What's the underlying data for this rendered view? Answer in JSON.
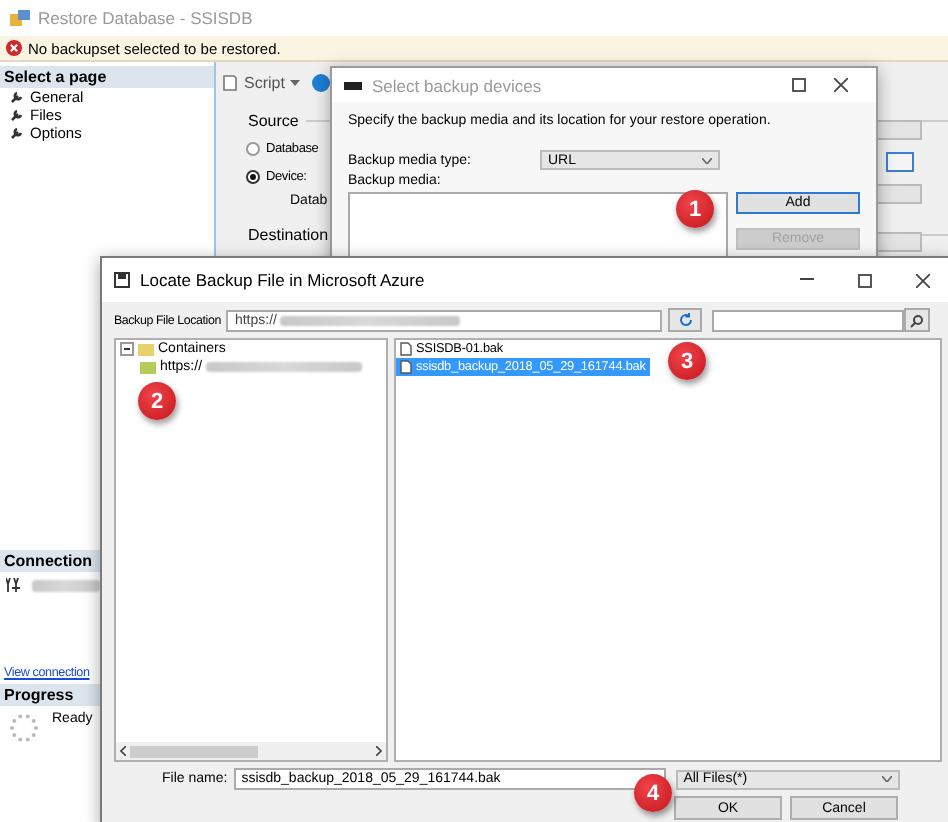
{
  "main_window": {
    "title": "Restore Database - SSISDB",
    "message": "No backupset selected to be restored.",
    "sidebar": {
      "header": "Select a page",
      "items": [
        {
          "label": "General"
        },
        {
          "label": "Files"
        },
        {
          "label": "Options"
        }
      ]
    },
    "connection": {
      "header": "Connection",
      "link": "View connection"
    },
    "progress": {
      "header": "Progress",
      "status": "Ready"
    },
    "toolbar": {
      "script": "Script"
    },
    "source": {
      "header": "Source",
      "options": [
        {
          "label": "Database",
          "selected": false
        },
        {
          "label": "Device:",
          "selected": true
        }
      ],
      "database_label": "Datab"
    },
    "destination": {
      "header": "Destination"
    }
  },
  "select_backup_dialog": {
    "title": "Select backup devices",
    "instructions": "Specify the backup media and its location for your restore operation.",
    "media_type_label": "Backup media type:",
    "media_type": "URL",
    "media_label": "Backup media:",
    "buttons": [
      {
        "label": "Add",
        "disabled": false
      },
      {
        "label": "Remove",
        "disabled": true
      }
    ]
  },
  "locate_dialog": {
    "title": "Locate Backup File in Microsoft Azure",
    "location_label": "Backup File Location",
    "location_value": "https://",
    "tree": [
      {
        "label": "Containers",
        "expanded": true,
        "children": [
          {
            "label": "https://"
          }
        ]
      }
    ],
    "files": [
      {
        "name": "SSISDB-01.bak",
        "selected": false
      },
      {
        "name": "ssisdb_backup_2018_05_29_161744.bak",
        "selected": true
      }
    ],
    "file_name_label": "File name:",
    "file_name": "ssisdb_backup_2018_05_29_161744.bak",
    "filter": "All Files(*)",
    "buttons": [
      "OK",
      "Cancel"
    ]
  },
  "callouts": [
    {
      "label": "1"
    },
    {
      "label": "2"
    },
    {
      "label": "3"
    },
    {
      "label": "4"
    }
  ]
}
